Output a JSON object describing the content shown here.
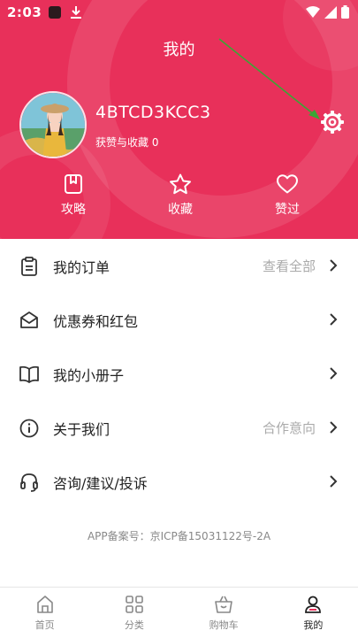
{
  "status_bar": {
    "time": "2:03",
    "icons": [
      "app-icon",
      "download-icon",
      "wifi-icon",
      "signal-icon",
      "battery-icon"
    ]
  },
  "header": {
    "title": "我的",
    "background_color": "#e8305a",
    "username": "4BTCD3KCC3",
    "likes_label": "获赞与收藏",
    "likes_count": "0",
    "settings_icon": "gear-icon",
    "quick_actions": [
      {
        "label": "攻略",
        "icon": "bookmark-icon"
      },
      {
        "label": "收藏",
        "icon": "star-icon"
      },
      {
        "label": "赞过",
        "icon": "heart-icon"
      }
    ]
  },
  "menu": {
    "items": [
      {
        "label": "我的订单",
        "hint": "查看全部",
        "icon": "clipboard-icon"
      },
      {
        "label": "优惠券和红包",
        "hint": "",
        "icon": "envelope-icon"
      },
      {
        "label": "我的小册子",
        "hint": "",
        "icon": "book-icon"
      },
      {
        "label": "关于我们",
        "hint": "合作意向",
        "icon": "info-icon"
      },
      {
        "label": "咨询/建议/投诉",
        "hint": "",
        "icon": "headset-icon"
      }
    ]
  },
  "footer": {
    "icp": "APP备案号：京ICP备15031122号-2A"
  },
  "tabbar": {
    "tabs": [
      {
        "label": "首页",
        "icon": "home-icon",
        "active": false
      },
      {
        "label": "分类",
        "icon": "grid-icon",
        "active": false
      },
      {
        "label": "购物车",
        "icon": "basket-icon",
        "active": false
      },
      {
        "label": "我的",
        "icon": "user-icon",
        "active": true
      }
    ]
  },
  "colors": {
    "accent": "#e8305a",
    "arrow": "#3aa635",
    "hint_text": "#aaaaaa"
  }
}
